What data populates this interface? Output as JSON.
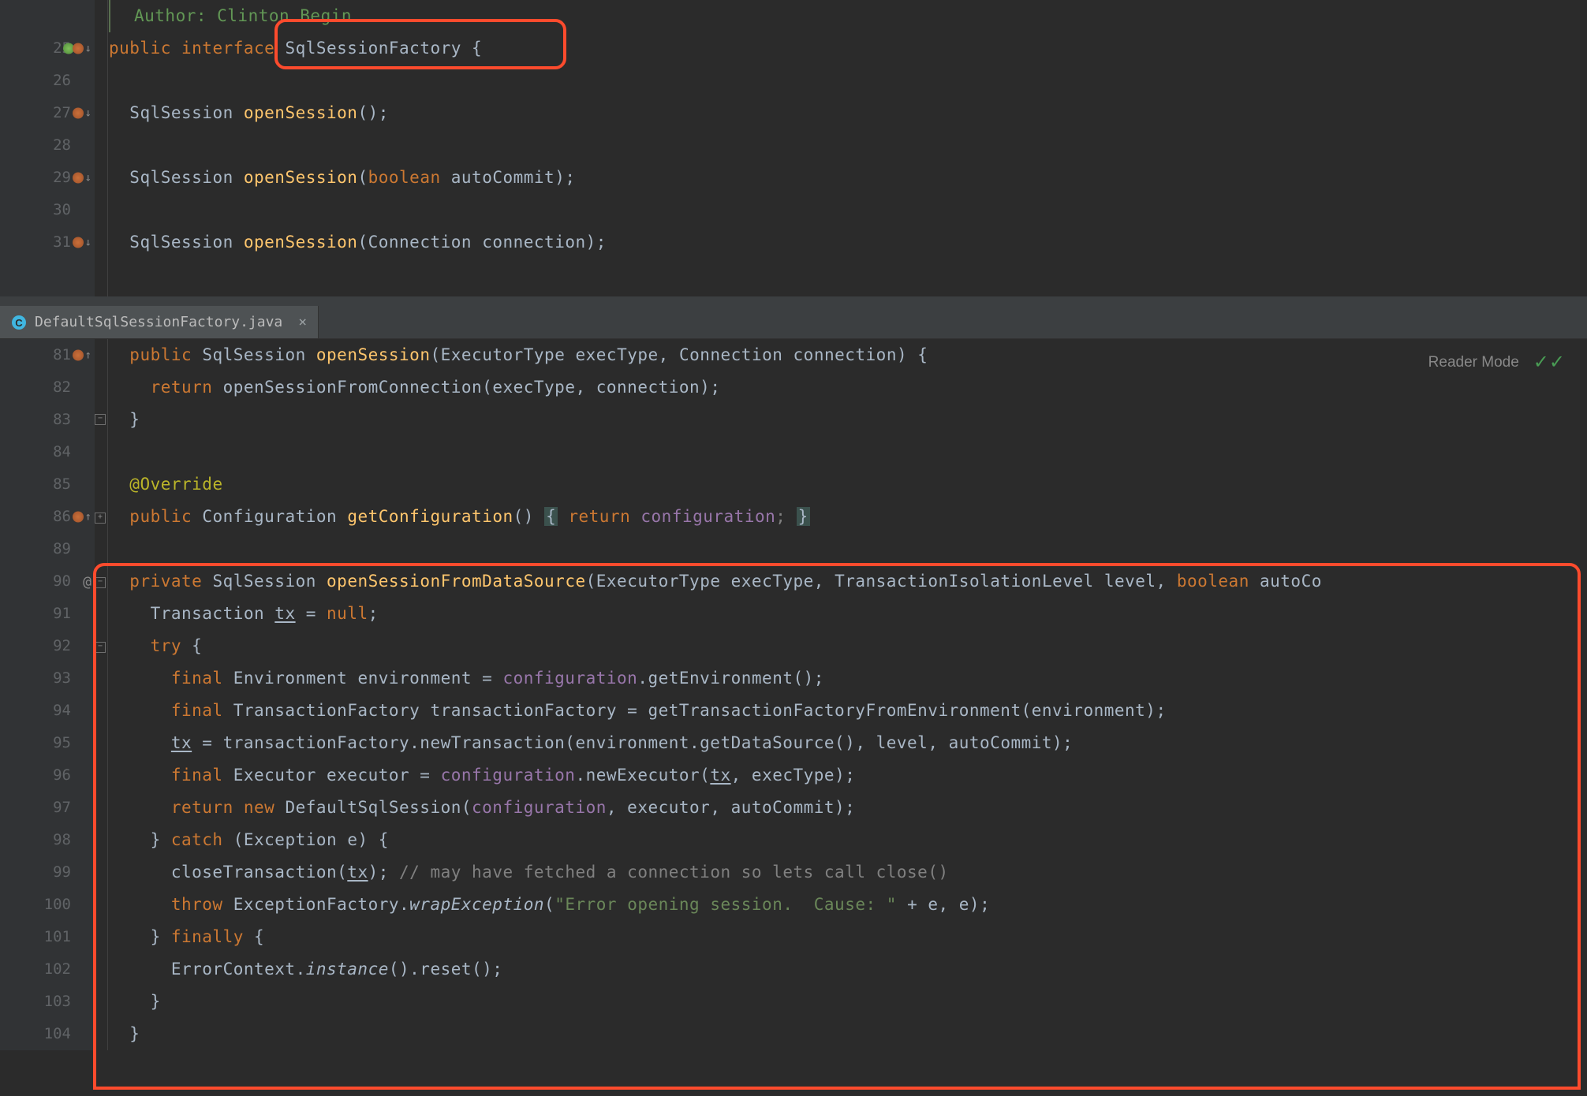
{
  "topEditor": {
    "authorComment": "Author: Clinton Begin",
    "lines": [
      {
        "num": 25,
        "marker": "green-down",
        "tokens": [
          [
            "kw",
            "public "
          ],
          [
            "kw",
            "interface "
          ],
          [
            "type",
            "SqlSessionFactory "
          ],
          [
            "",
            "{"
          ]
        ]
      },
      {
        "num": 26,
        "tokens": []
      },
      {
        "num": 27,
        "marker": "green-down-small",
        "tokens": [
          [
            "",
            "  "
          ],
          [
            "type",
            "SqlSession "
          ],
          [
            "method-decl",
            "openSession"
          ],
          [
            "",
            "();"
          ]
        ]
      },
      {
        "num": 28,
        "tokens": []
      },
      {
        "num": 29,
        "marker": "green-down-small",
        "tokens": [
          [
            "",
            "  "
          ],
          [
            "type",
            "SqlSession "
          ],
          [
            "method-decl",
            "openSession"
          ],
          [
            "",
            "("
          ],
          [
            "kw",
            "boolean "
          ],
          [
            "param",
            "autoCommit"
          ],
          [
            "",
            ");"
          ]
        ]
      },
      {
        "num": 30,
        "tokens": []
      },
      {
        "num": 31,
        "marker": "green-down-small",
        "tokens": [
          [
            "",
            "  "
          ],
          [
            "type",
            "SqlSession "
          ],
          [
            "method-decl",
            "openSession"
          ],
          [
            "",
            "("
          ],
          [
            "type",
            "Connection "
          ],
          [
            "param",
            "connection"
          ],
          [
            "",
            ");"
          ]
        ]
      }
    ]
  },
  "tab": {
    "filename": "DefaultSqlSessionFactory.java",
    "iconColor": "#40b6e0"
  },
  "readerMode": "Reader Mode",
  "bottomEditor": {
    "lines": [
      {
        "num": 81,
        "marker": "green-up",
        "tokens": [
          [
            "",
            "  "
          ],
          [
            "kw",
            "public "
          ],
          [
            "type",
            "SqlSession "
          ],
          [
            "method-decl",
            "openSession"
          ],
          [
            "",
            "("
          ],
          [
            "type",
            "ExecutorType "
          ],
          [
            "param",
            "execType"
          ],
          [
            "",
            ", "
          ],
          [
            "type",
            "Connection "
          ],
          [
            "param",
            "connection"
          ],
          [
            "",
            ") {"
          ]
        ]
      },
      {
        "num": 82,
        "tokens": [
          [
            "",
            "    "
          ],
          [
            "kw",
            "return "
          ],
          [
            "",
            "openSessionFromConnection(execType, connection);"
          ]
        ]
      },
      {
        "num": 83,
        "tokens": [
          [
            "",
            "  }"
          ]
        ]
      },
      {
        "num": 84,
        "tokens": []
      },
      {
        "num": 85,
        "tokens": [
          [
            "",
            "  "
          ],
          [
            "annot",
            "@Override"
          ]
        ]
      },
      {
        "num": 86,
        "marker": "green-up",
        "tokens": [
          [
            "",
            "  "
          ],
          [
            "kw",
            "public "
          ],
          [
            "type",
            "Configuration "
          ],
          [
            "method-decl",
            "getConfiguration"
          ],
          [
            "",
            "() "
          ],
          [
            "dim-brace",
            "{"
          ],
          [
            "comment",
            " "
          ],
          [
            "kw",
            "return "
          ],
          [
            "field",
            "configuration"
          ],
          [
            "comment",
            "; "
          ],
          [
            "dim-brace",
            "}"
          ]
        ]
      },
      {
        "num": 89,
        "tokens": []
      },
      {
        "num": 90,
        "marker": "at",
        "tokens": [
          [
            "",
            "  "
          ],
          [
            "kw",
            "private "
          ],
          [
            "type",
            "SqlSession "
          ],
          [
            "method-decl",
            "openSessionFromDataSource"
          ],
          [
            "",
            "("
          ],
          [
            "type",
            "ExecutorType "
          ],
          [
            "param",
            "execType"
          ],
          [
            "",
            ", "
          ],
          [
            "type",
            "TransactionIsolationLevel "
          ],
          [
            "param",
            "level"
          ],
          [
            "",
            ", "
          ],
          [
            "kw",
            "boolean "
          ],
          [
            "param",
            "autoCo"
          ]
        ]
      },
      {
        "num": 91,
        "tokens": [
          [
            "",
            "    "
          ],
          [
            "type",
            "Transaction "
          ],
          [
            "under",
            "tx"
          ],
          [
            "",
            " = "
          ],
          [
            "kw",
            "null"
          ],
          [
            "",
            ";"
          ]
        ]
      },
      {
        "num": 92,
        "tokens": [
          [
            "",
            "    "
          ],
          [
            "kw",
            "try "
          ],
          [
            "",
            "{"
          ]
        ]
      },
      {
        "num": 93,
        "tokens": [
          [
            "",
            "      "
          ],
          [
            "kw",
            "final "
          ],
          [
            "type",
            "Environment "
          ],
          [
            "",
            "environment = "
          ],
          [
            "field",
            "configuration"
          ],
          [
            "",
            ".getEnvironment();"
          ]
        ]
      },
      {
        "num": 94,
        "tokens": [
          [
            "",
            "      "
          ],
          [
            "kw",
            "final "
          ],
          [
            "type",
            "TransactionFactory "
          ],
          [
            "",
            "transactionFactory = getTransactionFactoryFromEnvironment(environment);"
          ]
        ]
      },
      {
        "num": 95,
        "tokens": [
          [
            "",
            "      "
          ],
          [
            "under",
            "tx"
          ],
          [
            "",
            " = transactionFactory.newTransaction(environment.getDataSource(), level, autoCommit);"
          ]
        ]
      },
      {
        "num": 96,
        "tokens": [
          [
            "",
            "      "
          ],
          [
            "kw",
            "final "
          ],
          [
            "type",
            "Executor "
          ],
          [
            "",
            "executor = "
          ],
          [
            "field",
            "configuration"
          ],
          [
            "",
            ".newExecutor("
          ],
          [
            "under",
            "tx"
          ],
          [
            "",
            ", execType);"
          ]
        ]
      },
      {
        "num": 97,
        "tokens": [
          [
            "",
            "      "
          ],
          [
            "kw",
            "return new "
          ],
          [
            "",
            "DefaultSqlSession("
          ],
          [
            "field",
            "configuration"
          ],
          [
            "",
            ", executor, autoCommit);"
          ]
        ]
      },
      {
        "num": 98,
        "tokens": [
          [
            "",
            "    } "
          ],
          [
            "kw",
            "catch "
          ],
          [
            "",
            "("
          ],
          [
            "type",
            "Exception "
          ],
          [
            "",
            "e) {"
          ]
        ]
      },
      {
        "num": 99,
        "tokens": [
          [
            "",
            "      closeTransaction("
          ],
          [
            "under",
            "tx"
          ],
          [
            "",
            "); "
          ],
          [
            "comment",
            "// may have fetched a connection so lets call close()"
          ]
        ]
      },
      {
        "num": 100,
        "tokens": [
          [
            "",
            "      "
          ],
          [
            "kw",
            "throw "
          ],
          [
            "",
            "ExceptionFactory."
          ],
          [
            "ital",
            "wrapException"
          ],
          [
            "",
            "("
          ],
          [
            "str",
            "\"Error opening session.  Cause: \""
          ],
          [
            "",
            " + e, e);"
          ]
        ]
      },
      {
        "num": 101,
        "tokens": [
          [
            "",
            "    } "
          ],
          [
            "kw",
            "finally "
          ],
          [
            "",
            "{"
          ]
        ]
      },
      {
        "num": 102,
        "tokens": [
          [
            "",
            "      ErrorContext."
          ],
          [
            "ital",
            "instance"
          ],
          [
            "",
            "().reset();"
          ]
        ]
      },
      {
        "num": 103,
        "tokens": [
          [
            "",
            "    }"
          ]
        ]
      },
      {
        "num": 104,
        "tokens": [
          [
            "",
            "  }"
          ]
        ]
      }
    ]
  }
}
